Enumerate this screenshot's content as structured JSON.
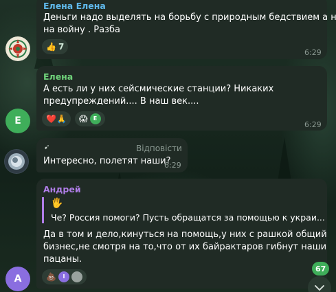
{
  "messages": [
    {
      "sender": "Елена Елена",
      "lines": [
        "Деньги надо выделять на борьбу с природным бедствием а не",
        "на войну . Разба"
      ],
      "reaction": {
        "emoji": "👍",
        "count": "7"
      },
      "time": "6:29"
    },
    {
      "sender": "Елена",
      "lines": [
        "А есть ли у них сейсмические станции? Никаких",
        "предупреждений.... В наш век...."
      ],
      "reactions": [
        "❤️🙏",
        "😱"
      ],
      "reaction_avatar_letter": "Е",
      "avatar_letter": "Е",
      "time": "6:29"
    },
    {
      "reply_label": "Відповісти",
      "lines": [
        "Интересно, полетят наши?"
      ],
      "time": "6:29"
    },
    {
      "sender": "Андрей",
      "quote_emoji": "🖐",
      "quote_text": "Че? Россия помоги? Пусть обращатся за помощью к украи...",
      "lines": [
        "Да в том и дело,кинуться на помощь,у них с рашкой общий",
        "бизнес,не смотря на то,что от их байрактаров гибнут наши",
        "пацаны."
      ],
      "reaction_emoji": "💩",
      "reaction_avatar_letter": "І",
      "avatar_letter": "А"
    }
  ],
  "scroll": {
    "unread_count": "67",
    "icon": "chevron-down-icon"
  },
  "colors": {
    "name_elena_elena": "#5fb8ea",
    "name_elena": "#6fd27a",
    "name_andrey": "#b07ee8",
    "avatar_e": "#3fae5a",
    "avatar_a": "#8a6ee0"
  }
}
